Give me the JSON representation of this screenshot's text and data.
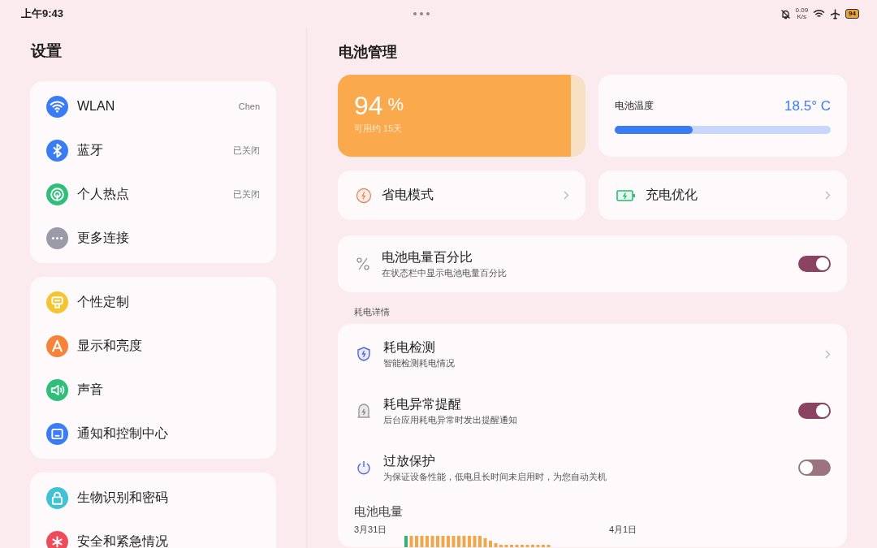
{
  "status_bar": {
    "time": "上午9:43",
    "speed": "0.09",
    "speed_unit": "K/s",
    "battery": "94"
  },
  "sidebar": {
    "title": "设置",
    "groups": [
      [
        {
          "label": "WLAN",
          "value": "Chen",
          "color": "#3a7bf6"
        },
        {
          "label": "蓝牙",
          "value": "已关闭",
          "color": "#3a7bf6"
        },
        {
          "label": "个人热点",
          "value": "已关闭",
          "color": "#2fbf7a"
        },
        {
          "label": "更多连接",
          "color": "#9a9aa8"
        }
      ],
      [
        {
          "label": "个性定制",
          "color": "#f5c431"
        },
        {
          "label": "显示和亮度",
          "color": "#f5843a"
        },
        {
          "label": "声音",
          "color": "#2fbf7a"
        },
        {
          "label": "通知和控制中心",
          "color": "#3a7bf6"
        }
      ],
      [
        {
          "label": "生物识别和密码",
          "color": "#3fc1d6"
        },
        {
          "label": "安全和紧急情况",
          "color": "#ef4a5a"
        }
      ]
    ]
  },
  "page": {
    "title": "电池管理",
    "battery": {
      "percent": "94",
      "unit": "%",
      "estimate": "可用约  15天",
      "level": 0.94
    },
    "temperature": {
      "label": "电池温度",
      "value": "18.5° C",
      "level": 0.36
    },
    "shortcuts": [
      {
        "label": "省电模式"
      },
      {
        "label": "充电优化"
      }
    ],
    "percent_row": {
      "title": "电池电量百分比",
      "subtitle": "在状态栏中显示电池电量百分比",
      "on": true
    },
    "section_label": "耗电详情",
    "details": [
      {
        "kind": "link",
        "title": "耗电检测",
        "subtitle": "智能检测耗电情况"
      },
      {
        "kind": "toggle",
        "title": "耗电异常提醒",
        "subtitle": "后台应用耗电异常时发出提醒通知",
        "on": true
      },
      {
        "kind": "toggle",
        "title": "过放保护",
        "subtitle": "为保证设备性能，低电且长时间未启用时，为您自动关机",
        "on": false
      }
    ],
    "chart": {
      "title": "电池电量",
      "day_1": "3月31日",
      "day_2": "4月1日"
    }
  }
}
